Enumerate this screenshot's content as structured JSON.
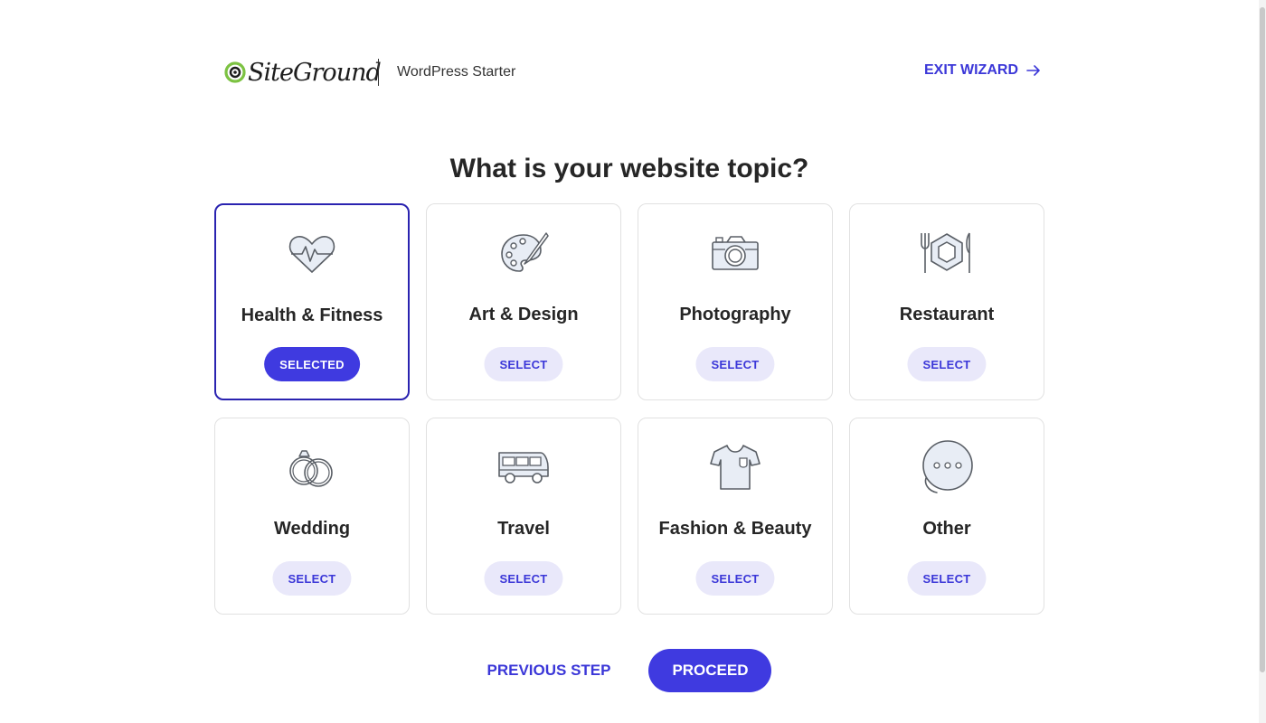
{
  "header": {
    "logo_text": "SiteGround",
    "product": "WordPress Starter",
    "exit_label": "EXIT WIZARD"
  },
  "title": "What is your website topic?",
  "topics": [
    {
      "label": "Health & Fitness",
      "button": "SELECTED",
      "selected": true,
      "icon": "heart-pulse-icon"
    },
    {
      "label": "Art & Design",
      "button": "SELECT",
      "selected": false,
      "icon": "palette-icon"
    },
    {
      "label": "Photography",
      "button": "SELECT",
      "selected": false,
      "icon": "camera-icon"
    },
    {
      "label": "Restaurant",
      "button": "SELECT",
      "selected": false,
      "icon": "plate-cutlery-icon"
    },
    {
      "label": "Wedding",
      "button": "SELECT",
      "selected": false,
      "icon": "rings-icon"
    },
    {
      "label": "Travel",
      "button": "SELECT",
      "selected": false,
      "icon": "bus-icon"
    },
    {
      "label": "Fashion & Beauty",
      "button": "SELECT",
      "selected": false,
      "icon": "tshirt-icon"
    },
    {
      "label": "Other",
      "button": "SELECT",
      "selected": false,
      "icon": "chat-bubble-icon"
    }
  ],
  "footer": {
    "previous_label": "PREVIOUS STEP",
    "proceed_label": "PROCEED"
  },
  "colors": {
    "accent": "#3f3ae0",
    "link": "#3b37d8",
    "selected_border": "#2a23b0",
    "button_light": "#e9e8fa",
    "logo_green": "#7cc242"
  }
}
